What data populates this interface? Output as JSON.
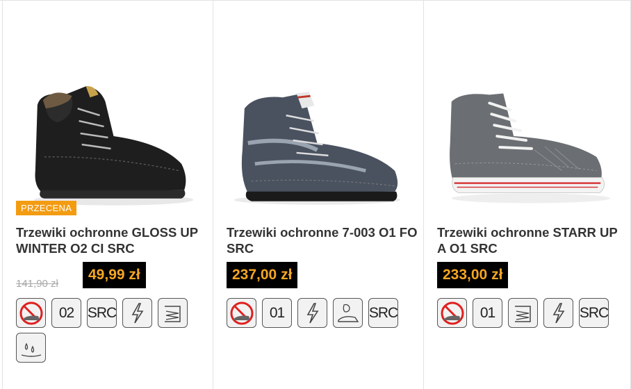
{
  "products": [
    {
      "title": "Trzewiki ochronne GLOSS UP WINTER O2 CI SRC",
      "badge": "PRZECENA",
      "old_price": "141,90 zł",
      "price": "49,99 zł",
      "image": "black-leather-winter-boot",
      "icons": [
        "no-metal-icon",
        "02",
        "SRC",
        "lightning-icon",
        "insole-icon",
        "water-drops-icon"
      ]
    },
    {
      "title": "Trzewiki ochronne 7-003 O1 FO SRC",
      "price": "237,00 zł",
      "image": "grey-suede-hiking-boot",
      "icons": [
        "no-metal-icon",
        "01",
        "lightning-icon",
        "oil-resistant-icon",
        "SRC"
      ]
    },
    {
      "title": "Trzewiki ochronne STARR UP A O1 SRC",
      "price": "233,00 zł",
      "image": "grey-sneaker-boot",
      "icons": [
        "no-metal-icon",
        "01",
        "insole-icon",
        "lightning-icon",
        "SRC"
      ]
    }
  ],
  "colors": {
    "badge": "#f39c12",
    "price_bg": "#000000",
    "price_text": "#f5a623",
    "old_price": "#a8a8a8"
  }
}
